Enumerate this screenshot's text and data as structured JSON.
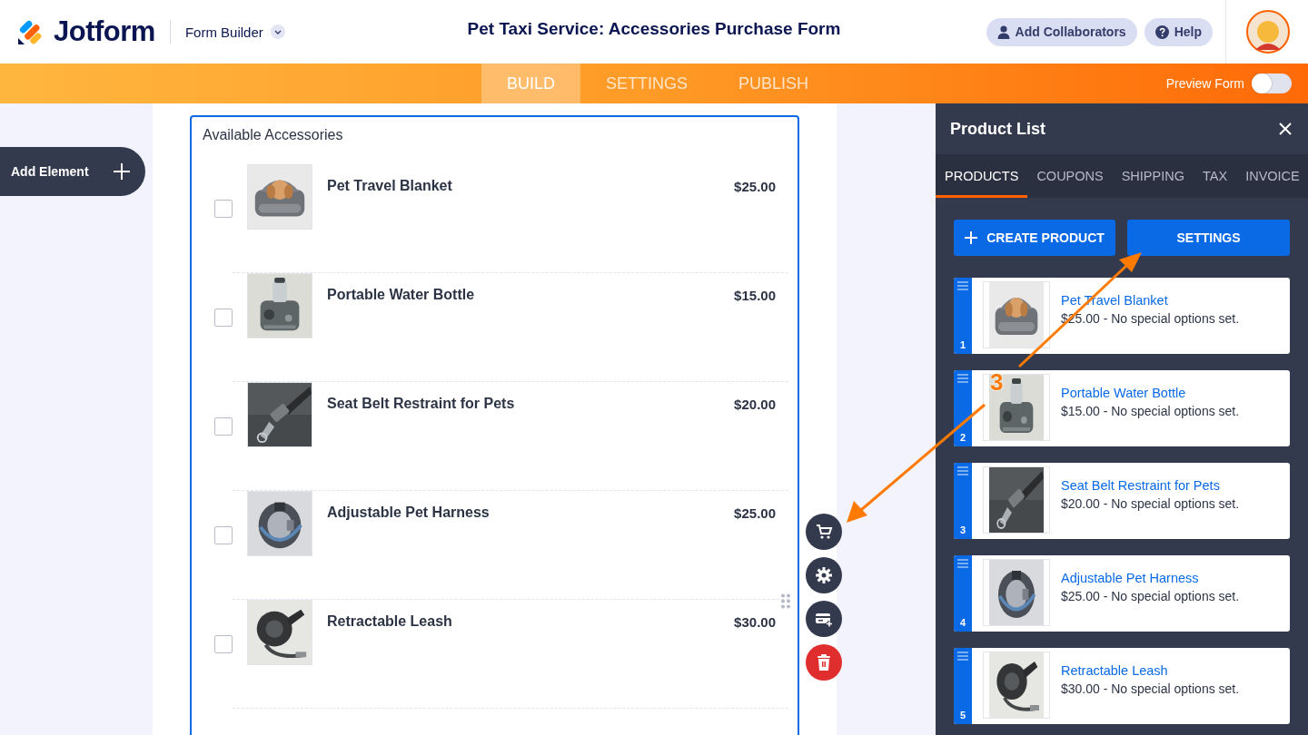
{
  "header": {
    "logo": "Jotform",
    "app_switcher": "Form Builder",
    "form_title": "Pet Taxi Service: Accessories Purchase Form",
    "buttons": [
      {
        "kind": "collaborators",
        "label": "Add Collaborators"
      },
      {
        "kind": "help",
        "label": "Help"
      }
    ]
  },
  "nav": {
    "tabs": [
      {
        "label": "BUILD",
        "selected": true
      },
      {
        "label": "SETTINGS",
        "selected": false
      },
      {
        "label": "PUBLISH",
        "selected": false
      }
    ],
    "preview": {
      "label": "Preview Form",
      "on": false
    }
  },
  "sidebar": {
    "add_element": "Add Element"
  },
  "form": {
    "field_label": "Available Accessories",
    "products": [
      {
        "name": "Pet Travel Blanket",
        "price": "$25.00",
        "checked": false,
        "kind": "blanket"
      },
      {
        "name": "Portable Water Bottle",
        "price": "$15.00",
        "checked": false,
        "kind": "bottle"
      },
      {
        "name": "Seat Belt Restraint for Pets",
        "price": "$20.00",
        "checked": false,
        "kind": "belt"
      },
      {
        "name": "Adjustable Pet Harness",
        "price": "$25.00",
        "checked": false,
        "kind": "harness"
      },
      {
        "name": "Retractable Leash",
        "price": "$30.00",
        "checked": false,
        "kind": "leash"
      }
    ],
    "tools": [
      {
        "kind": "cart"
      },
      {
        "kind": "gear"
      },
      {
        "kind": "card"
      },
      {
        "kind": "trash"
      }
    ]
  },
  "panel": {
    "title": "Product List",
    "tabs": [
      {
        "label": "PRODUCTS",
        "selected": true
      },
      {
        "label": "COUPONS",
        "selected": false
      },
      {
        "label": "SHIPPING",
        "selected": false
      },
      {
        "label": "TAX",
        "selected": false
      },
      {
        "label": "INVOICE",
        "selected": false
      }
    ],
    "create_button": "CREATE PRODUCT",
    "settings_button": "SETTINGS",
    "items": [
      {
        "number": "1",
        "name": "Pet Travel Blanket",
        "details": "$25.00 - No special options set.",
        "kind": "blanket"
      },
      {
        "number": "2",
        "name": "Portable Water Bottle",
        "details": "$15.00 - No special options set.",
        "kind": "bottle"
      },
      {
        "number": "3",
        "name": "Seat Belt Restraint for Pets",
        "details": "$20.00 - No special options set.",
        "kind": "belt"
      },
      {
        "number": "4",
        "name": "Adjustable Pet Harness",
        "details": "$25.00 - No special options set.",
        "kind": "harness"
      },
      {
        "number": "5",
        "name": "Retractable Leash",
        "details": "$30.00 - No special options set.",
        "kind": "leash"
      }
    ]
  },
  "annotation": {
    "step": "3"
  }
}
